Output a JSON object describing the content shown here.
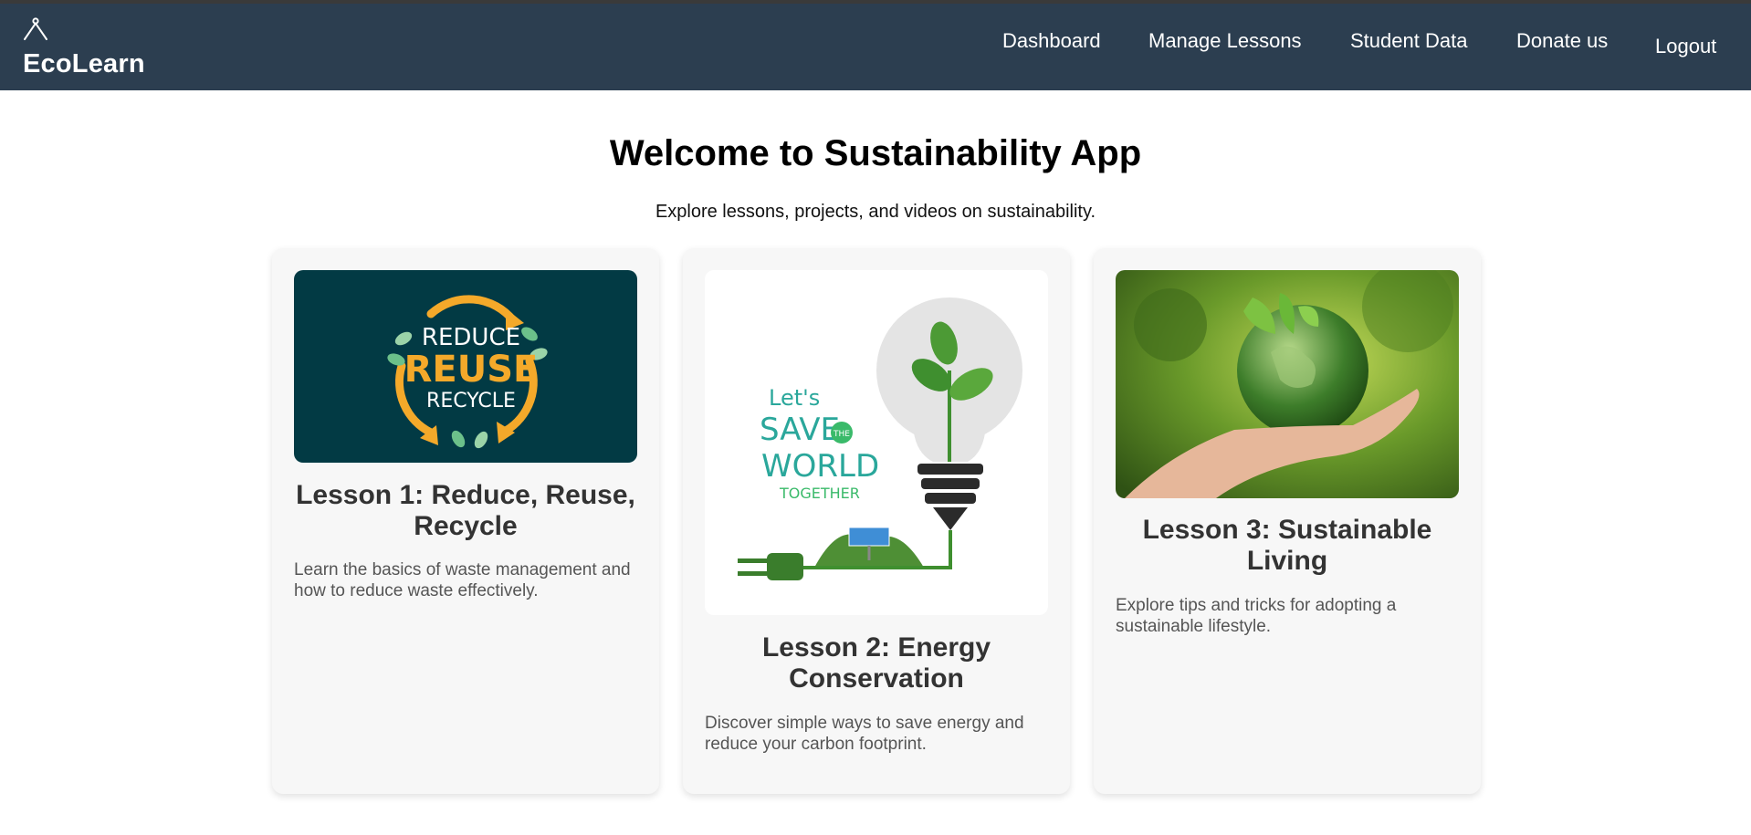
{
  "brand": {
    "name": "EcoLearn",
    "icon": "hanger-icon"
  },
  "nav": {
    "dashboard": "Dashboard",
    "manage_lessons": "Manage Lessons",
    "student_data": "Student Data",
    "donate": "Donate us",
    "logout": "Logout"
  },
  "main": {
    "title": "Welcome to Sustainability App",
    "subtitle": "Explore lessons, projects, and videos on sustainability."
  },
  "lessons": [
    {
      "title": "Lesson 1: Reduce, Reuse, Recycle",
      "description": "Learn the basics of waste management and how to reduce waste effectively.",
      "image": {
        "name": "reduce-reuse-recycle-image",
        "line1": "REDUCE",
        "line2": "REUSE",
        "line3": "RECYCLE"
      }
    },
    {
      "title": "Lesson 2: Energy Conservation",
      "description": "Discover simple ways to save energy and reduce your carbon footprint.",
      "image": {
        "name": "save-the-world-lightbulb-image",
        "line1": "Let's",
        "line2": "SAVE",
        "line3": "THE",
        "line4": "WORLD",
        "line5": "TOGETHER"
      }
    },
    {
      "title": "Lesson 3: Sustainable Living",
      "description": "Explore tips and tricks for adopting a sustainable lifestyle.",
      "image": {
        "name": "hand-holding-earth-image"
      }
    }
  ],
  "colors": {
    "navbar": "#2c3e50",
    "card": "#f7f7f7",
    "recycle_bg": "#023a44",
    "recycle_orange": "#f4a92a",
    "eco_green": "#3f8f2f",
    "teal_text": "#2aa79b"
  }
}
